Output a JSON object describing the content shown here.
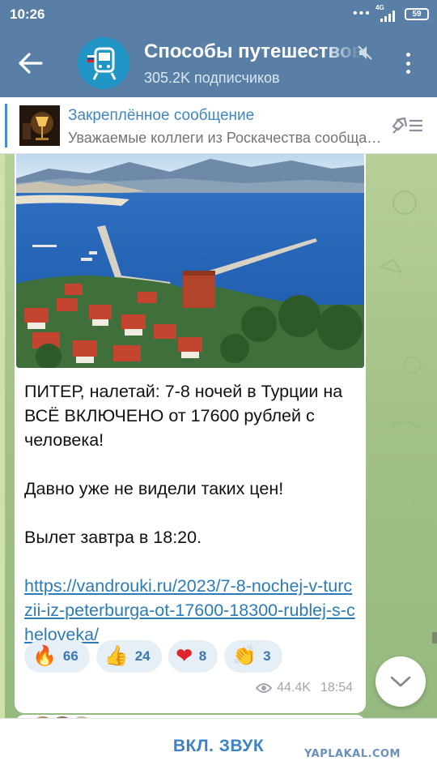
{
  "status_bar": {
    "time": "10:26",
    "network": "4G",
    "battery": "59"
  },
  "channel": {
    "title": "Способы путешествовать",
    "subscribers": "305.2K подписчиков"
  },
  "pinned": {
    "title": "Закреплённое сообщение",
    "text": "Уважаемые коллеги из Роскачества сообщают..."
  },
  "message": {
    "text": "ПИТЕР, налетай: 7-8 ночей в Турции на ВСЁ ВКЛЮЧЕНО от 17600 рублей с человека!\n\nДавно уже не видели таких цен!\n\nВылет завтра в 18:20.",
    "link": "https://vandrouki.ru/2023/7-8-nochej-v-turczii-iz-peterburga-ot-17600-18300-rublej-s-cheloveka/",
    "reactions": [
      {
        "emoji": "🔥",
        "count": "66"
      },
      {
        "emoji": "👍",
        "count": "24"
      },
      {
        "emoji": "❤",
        "count": "8"
      },
      {
        "emoji": "👏",
        "count": "3"
      }
    ],
    "views": "44.4K",
    "time": "18:54"
  },
  "bottom": {
    "unmute_label": "ВКЛ. ЗВУК",
    "watermark": "YAPLAKAL.COM"
  },
  "colors": {
    "header": "#5a7fa6",
    "accent": "#3d82c4",
    "link": "#2c7ab8",
    "chat_bg": "#a8c48f"
  },
  "icons": [
    "back-arrow-icon",
    "channel-avatar",
    "mute-icon",
    "more-vert-icon",
    "unpin-icon",
    "eye-icon",
    "chevron-down-icon"
  ]
}
